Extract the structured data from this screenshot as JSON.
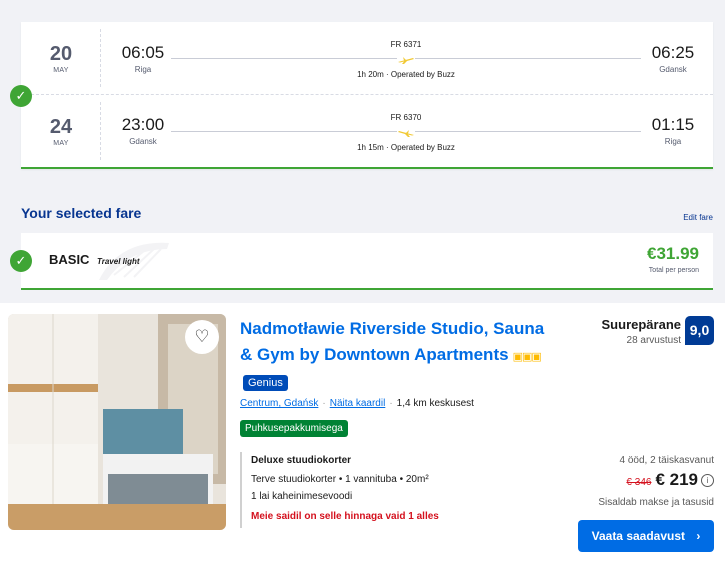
{
  "flights": {
    "outbound": {
      "day": "20",
      "month": "MAY",
      "dep_time": "06:05",
      "dep_city": "Riga",
      "arr_time": "06:25",
      "arr_city": "Gdansk",
      "flight_no": "FR 6371",
      "duration": "1h 20m · Operated by Buzz"
    },
    "return": {
      "day": "24",
      "month": "MAY",
      "dep_time": "23:00",
      "dep_city": "Gdansk",
      "arr_time": "01:15",
      "arr_city": "Riga",
      "flight_no": "FR 6370",
      "duration": "1h 15m · Operated by Buzz"
    }
  },
  "fare": {
    "heading": "Your selected fare",
    "edit_label": "Edit fare",
    "name": "BASIC",
    "subtitle": "Travel light",
    "price": "€31.99",
    "per": "Total per person"
  },
  "hotel": {
    "name": "Nadmotławie Riverside Studio, Sauna & Gym by Downtown Apartments",
    "stars": "▣▣▣",
    "genius": "Genius",
    "location_link": "Centrum, Gdańsk",
    "map_link": "Näita kaardil",
    "distance": "1,4 km keskusest",
    "deal": "Puhkusepakkumisega",
    "room_title": "Deluxe stuudiokorter",
    "room_desc": "Terve stuudiokorter • 1 vannituba • 20m²",
    "bed": "1 lai kaheinimesevoodi",
    "warning": "Meie saidil on selle hinnaga vaid 1 alles",
    "review_word": "Suurepärane",
    "review_count": "28 arvustust",
    "score": "9,0",
    "nights": "4 ööd, 2 täiskasvanut",
    "old_price": "€ 346",
    "new_price": "€ 219",
    "tax": "Sisaldab makse ja tasusid",
    "cta": "Vaata saadavust"
  },
  "colors": {
    "accent_green": "#3fa535",
    "ryanair_blue": "#073590",
    "booking_blue": "#006ce4",
    "score_blue": "#003b95",
    "plane_yellow": "#f1c933"
  }
}
